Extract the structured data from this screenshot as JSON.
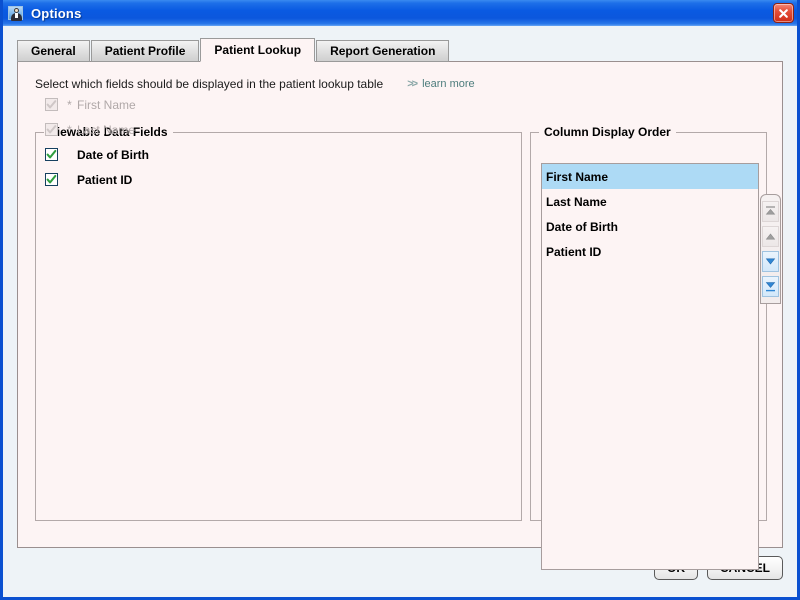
{
  "window": {
    "title": "Options",
    "icon": "options-person-icon",
    "close_label": "Close"
  },
  "tabs": [
    {
      "label": "General",
      "active": false
    },
    {
      "label": "Patient Profile",
      "active": false
    },
    {
      "label": "Patient Lookup",
      "active": true
    },
    {
      "label": "Report Generation",
      "active": false
    }
  ],
  "instruction": {
    "text": "Select which fields should be displayed in the patient lookup table",
    "link_chevrons": "»",
    "link_label": "learn more"
  },
  "viewable_fields": {
    "legend": "Viewable Data Fields",
    "items": [
      {
        "label": "First Name",
        "checked": true,
        "enabled": false,
        "required_marker": "*"
      },
      {
        "label": "Last Name",
        "checked": true,
        "enabled": false,
        "required_marker": "*"
      },
      {
        "label": "Date of Birth",
        "checked": true,
        "enabled": true,
        "required_marker": ""
      },
      {
        "label": "Patient ID",
        "checked": true,
        "enabled": true,
        "required_marker": ""
      }
    ]
  },
  "column_order": {
    "legend": "Column Display Order",
    "items": [
      {
        "label": "First Name",
        "selected": true
      },
      {
        "label": "Last Name",
        "selected": false
      },
      {
        "label": "Date of Birth",
        "selected": false
      },
      {
        "label": "Patient ID",
        "selected": false
      }
    ],
    "buttons": [
      {
        "name": "move-to-top-button",
        "icon": "double-chevron-up-icon",
        "enabled": false
      },
      {
        "name": "move-up-button",
        "icon": "chevron-up-icon",
        "enabled": false
      },
      {
        "name": "move-down-button",
        "icon": "chevron-down-icon",
        "enabled": true
      },
      {
        "name": "move-to-bottom-button",
        "icon": "double-chevron-down-icon",
        "enabled": true
      }
    ]
  },
  "footer": {
    "ok_label": "OK",
    "cancel_label": "CANCEL"
  },
  "colors": {
    "titlebar_blue": "#0b57dd",
    "window_border": "#0a50d0",
    "panel_background": "#fdf4f4",
    "dialog_background": "#eef3f7",
    "selection_blue": "#addaf5",
    "link_teal": "#4e7d7d",
    "checkbox_border": "#16405f",
    "checkmark_green": "#2f9e3f",
    "close_red": "#cf2b16"
  }
}
